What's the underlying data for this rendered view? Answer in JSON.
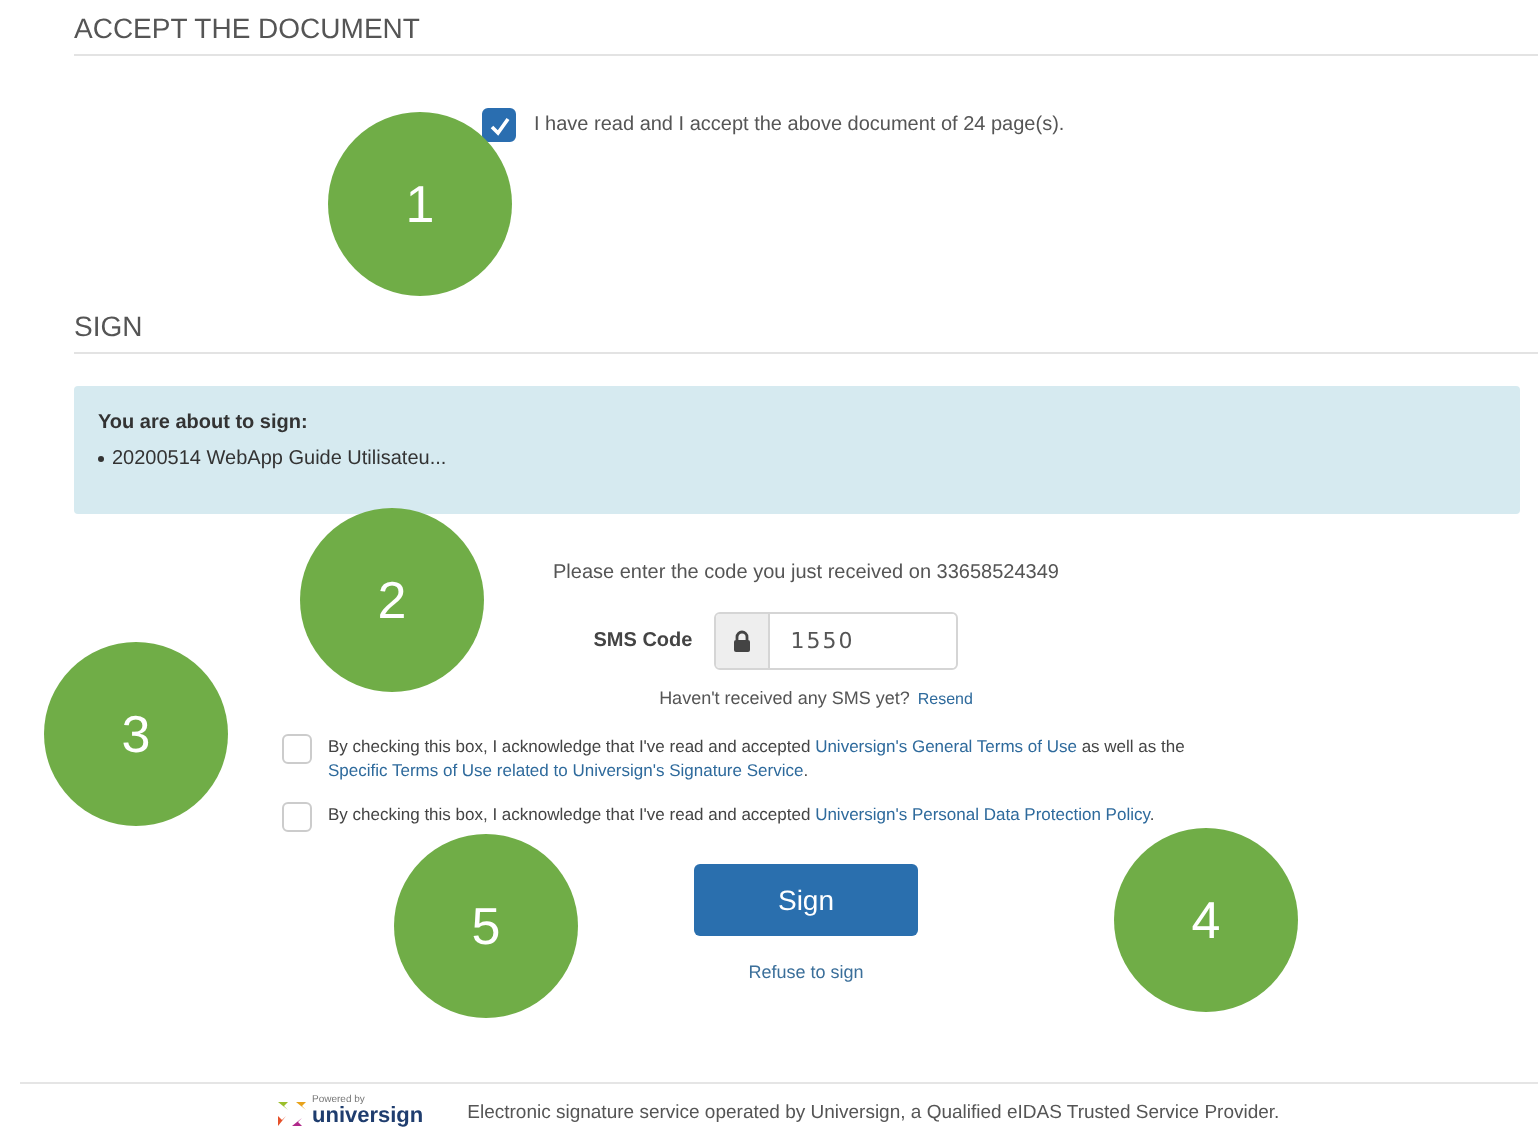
{
  "accept_section": {
    "heading": "ACCEPT THE DOCUMENT",
    "checkbox": {
      "label": "I have read and I accept the above document of 24 page(s).",
      "checked": true
    }
  },
  "sign_section": {
    "heading": "SIGN",
    "notice": {
      "title": "You are about to sign:",
      "documents": [
        "20200514 WebApp Guide Utilisateu..."
      ]
    },
    "code_prompt": "Please enter the code you just received on 33658524349",
    "sms_field": {
      "label": "SMS Code",
      "value": "1550"
    },
    "resend_prompt": "Haven't received any SMS yet?",
    "resend_link": "Resend",
    "consents": [
      {
        "checked": false,
        "parts": [
          {
            "text": "By checking this box, I acknowledge that I've read and accepted ",
            "link": false
          },
          {
            "text": "Universign's General Terms of Use",
            "link": true
          },
          {
            "text": " as well as the ",
            "link": false
          },
          {
            "text": "Specific Terms of Use related to Universign's Signature Service",
            "link": true
          },
          {
            "text": ".",
            "link": false
          }
        ]
      },
      {
        "checked": false,
        "parts": [
          {
            "text": "By checking this box, I acknowledge that I've read and accepted ",
            "link": false
          },
          {
            "text": "Universign's Personal Data Protection Policy",
            "link": true
          },
          {
            "text": ".",
            "link": false
          }
        ]
      }
    ],
    "sign_button": "Sign",
    "refuse_link": "Refuse to sign"
  },
  "footer": {
    "logo_caption": "Powered by",
    "logo_name": "universign",
    "text": "Electronic signature service operated by Universign, a Qualified eIDAS Trusted Service Provider."
  },
  "callouts": [
    {
      "label": "1"
    },
    {
      "label": "2"
    },
    {
      "label": "3"
    },
    {
      "label": "5"
    },
    {
      "label": "4"
    }
  ]
}
